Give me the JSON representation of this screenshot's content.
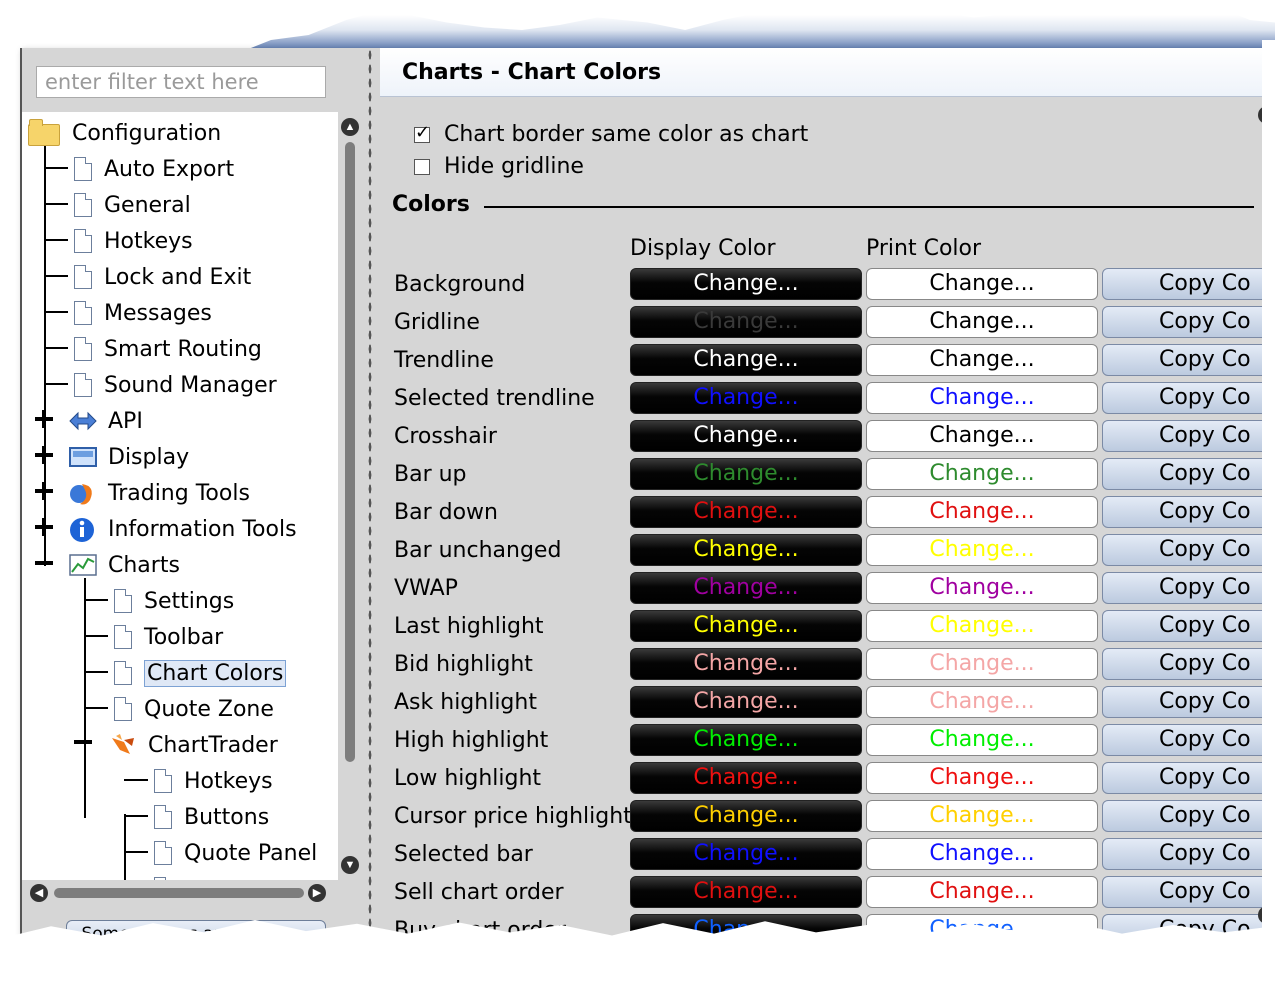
{
  "sidebar": {
    "filter_placeholder": "enter filter text here",
    "tree": {
      "configuration": "Configuration",
      "auto_export": "Auto Export",
      "general": "General",
      "hotkeys": "Hotkeys",
      "lock_and_exit": "Lock and Exit",
      "messages": "Messages",
      "smart_routing": "Smart Routing",
      "sound_manager": "Sound Manager",
      "api": "API",
      "display": "Display",
      "trading_tools": "Trading Tools",
      "information_tools": "Information Tools",
      "charts": "Charts",
      "settings": "Settings",
      "toolbar": "Toolbar",
      "chart_colors": "Chart Colors",
      "quote_zone": "Quote Zone",
      "charttrader": "ChartTrader",
      "ct_hotkeys": "Hotkeys",
      "ct_buttons": "Buttons",
      "ct_quote_panel": "Quote Panel"
    },
    "hidden_options_button": "Some options are hidden..."
  },
  "panel": {
    "title": "Charts - Chart Colors",
    "checkbox_border": {
      "label": "Chart border same color as chart",
      "checked": true
    },
    "checkbox_gridline": {
      "label": "Hide gridline",
      "checked": false
    },
    "section_title": "Colors",
    "col_display": "Display Color",
    "col_print": "Print Color",
    "change_label": "Change...",
    "copy_label": "Copy Co",
    "rows": [
      {
        "label": "Background",
        "display_color": "#ffffff",
        "print_color": "#000000"
      },
      {
        "label": "Gridline",
        "display_color": "#3a3a3a",
        "print_color": "#000000"
      },
      {
        "label": "Trendline",
        "display_color": "#ffffff",
        "print_color": "#000000"
      },
      {
        "label": "Selected trendline",
        "display_color": "#1010ff",
        "print_color": "#1010ff"
      },
      {
        "label": "Crosshair",
        "display_color": "#ffffff",
        "print_color": "#000000"
      },
      {
        "label": "Bar up",
        "display_color": "#2e8b2e",
        "print_color": "#2e8b2e"
      },
      {
        "label": "Bar down",
        "display_color": "#e01010",
        "print_color": "#e01010"
      },
      {
        "label": "Bar unchanged",
        "display_color": "#ffff00",
        "print_color": "#ffff00"
      },
      {
        "label": "VWAP",
        "display_color": "#a000a0",
        "print_color": "#a000a0"
      },
      {
        "label": "Last highlight",
        "display_color": "#ffff00",
        "print_color": "#ffff00"
      },
      {
        "label": "Bid highlight",
        "display_color": "#f4a6a6",
        "print_color": "#f4a6a6"
      },
      {
        "label": "Ask highlight",
        "display_color": "#f4a6a6",
        "print_color": "#f4a6a6"
      },
      {
        "label": "High highlight",
        "display_color": "#00ee00",
        "print_color": "#00ee00"
      },
      {
        "label": "Low highlight",
        "display_color": "#ee1010",
        "print_color": "#ee1010"
      },
      {
        "label": "Cursor price highlight",
        "display_color": "#ffd000",
        "print_color": "#ffd000"
      },
      {
        "label": "Selected bar",
        "display_color": "#1010ff",
        "print_color": "#1010ff"
      },
      {
        "label": "Sell chart order",
        "display_color": "#e01010",
        "print_color": "#e01010"
      },
      {
        "label": "Buy chart order",
        "display_color": "#1060ff",
        "print_color": "#1060ff"
      }
    ]
  }
}
